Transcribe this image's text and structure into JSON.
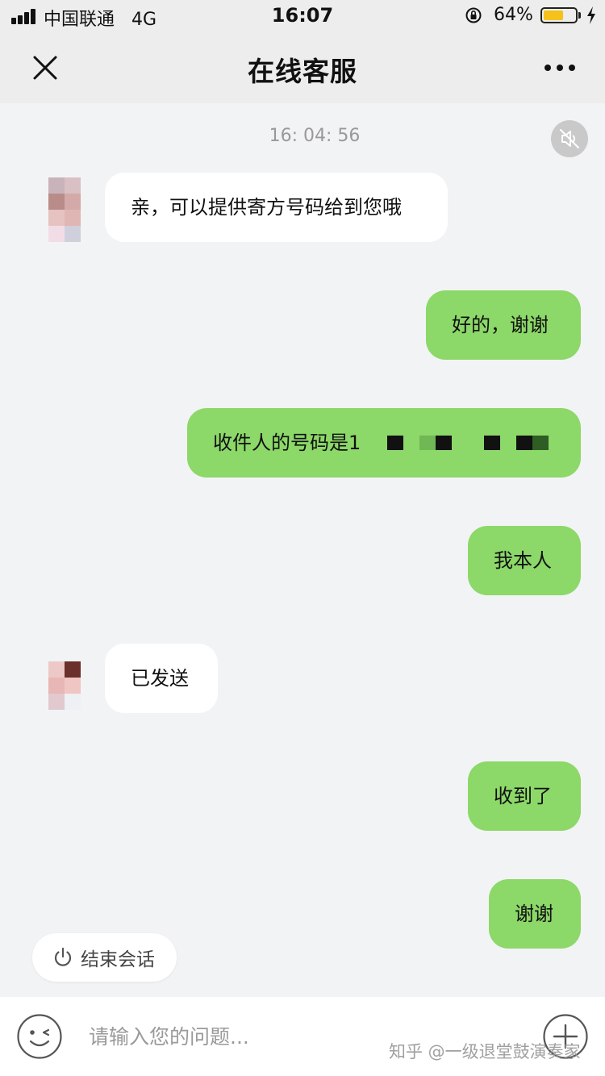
{
  "status_bar": {
    "carrier": "中国联通",
    "network": "4G",
    "time": "16:07",
    "battery_percent": "64%",
    "battery_level": 0.64,
    "icons": [
      "signal-icon",
      "orientation-lock-icon",
      "battery-icon",
      "charging-bolt-icon"
    ]
  },
  "header": {
    "title": "在线客服",
    "close_icon": "close-icon",
    "more_icon": "more-icon"
  },
  "chat": {
    "timestamp": "16: 04: 56",
    "mute_icon": "speaker-muted-icon",
    "messages": [
      {
        "from": "agent",
        "text": "亲，可以提供寄方号码给到您哦"
      },
      {
        "from": "user",
        "text": "好的，谢谢"
      },
      {
        "from": "user",
        "text": "收件人的号码是1"
      },
      {
        "from": "user",
        "text": "我本人"
      },
      {
        "from": "agent",
        "text": "已发送"
      },
      {
        "from": "user",
        "text": "收到了"
      },
      {
        "from": "user",
        "text": "谢谢"
      }
    ],
    "colors": {
      "user_bubble": "#8cd868",
      "agent_bubble": "#ffffff",
      "background": "#f2f3f5"
    }
  },
  "end_session": {
    "label": "结束会话",
    "icon": "power-icon"
  },
  "input_bar": {
    "placeholder": "请输入您的问题...",
    "emoji_icon": "emoji-icon",
    "plus_icon": "plus-icon"
  },
  "watermark": "知乎 @一级退堂鼓演奏家"
}
